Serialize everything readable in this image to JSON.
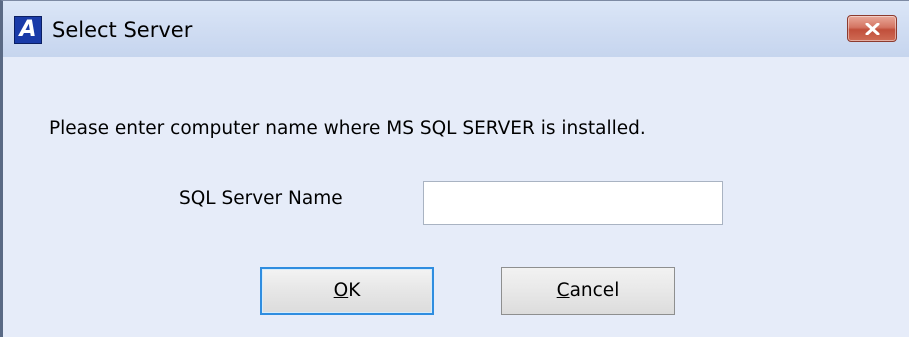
{
  "window": {
    "title": "Select Server",
    "app_icon_letter": "A",
    "app_icon": "app-logo-icon",
    "close_icon": "close-icon",
    "close_button_color": "#c14f3b",
    "accent_color": "#2f8de0"
  },
  "dialog": {
    "message": "Please enter computer name where MS SQL SERVER is installed.",
    "server_name_label": "SQL Server Name",
    "server_name_value": "",
    "server_name_placeholder": ""
  },
  "buttons": {
    "ok": {
      "mnemonic": "O",
      "rest": "K"
    },
    "cancel": {
      "mnemonic": "C",
      "rest": "ancel"
    }
  }
}
